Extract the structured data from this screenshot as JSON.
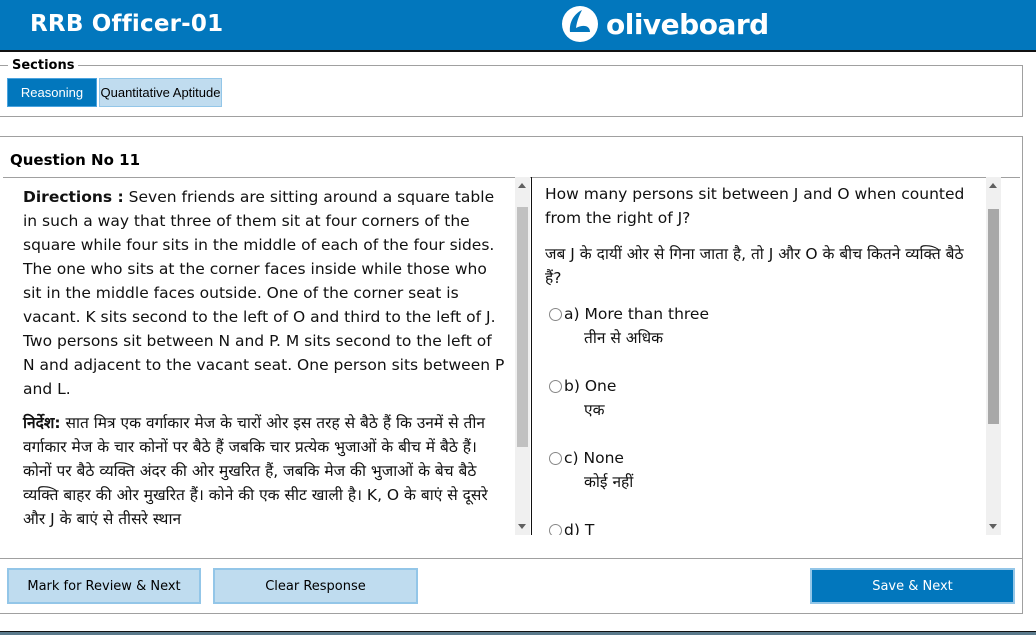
{
  "header": {
    "title": "RRB Officer-01",
    "brand": "oliveboard",
    "logo_icon": "oliveboard-logo-icon",
    "colors": {
      "primary": "#0277bd",
      "tab_inactive": "#c0dcef"
    }
  },
  "sections": {
    "legend": "Sections",
    "tabs": [
      {
        "label": "Reasoning",
        "active": true
      },
      {
        "label": "Quantitative Aptitude",
        "active": false
      }
    ]
  },
  "question": {
    "title": "Question No 11",
    "directions_label": "Directions :",
    "directions_text": " Seven friends are sitting around a square table in such a way that three of them sit at four corners of the square while four sits in the middle of each of the four sides. The one who sits at the corner faces inside while those who sit in the middle faces outside. One of the corner seat is vacant. K sits second to the left of O and third to the left of J. Two persons sit between N and P. M sits second to the left of N and adjacent to the vacant seat. One person sits between P and L.",
    "directions_hi_label": "निर्देश:",
    "directions_hi_text": " सात मित्र एक वर्गाकार मेज के चारों ओर इस तरह से बैठे हैं कि उनमें से तीन वर्गाकार मेज के चार कोनों पर बैठे हैं जबकि चार प्रत्येक भुजाओं के बीच में बैठे हैं। कोनों पर बैठे व्यक्ति अंदर की ओर मुखरित हैं, जबकि मेज की भुजाओं के बेच बैठे व्यक्ति बाहर की ओर मुखरित हैं। कोने की एक सीट खाली है। K, O के बाएं से दूसरे और J के बाएं से तीसरे स्थान",
    "text_en": "How many persons sit between J and O when counted from the right of J?",
    "text_hi": "जब J के दायीं ओर से गिना जाता है, तो J और O के बीच कितने व्यक्ति बैठे हैं?",
    "options": [
      {
        "key": "a)",
        "en": "More than three",
        "hi": "तीन से अधिक",
        "selected": false
      },
      {
        "key": "b)",
        "en": "One",
        "hi": "एक",
        "selected": false
      },
      {
        "key": "c)",
        "en": "None",
        "hi": "कोई नहीं",
        "selected": false
      },
      {
        "key": "d)",
        "en": "T",
        "hi": "",
        "selected": false
      }
    ]
  },
  "actions": {
    "mark_review": "Mark for Review & Next",
    "clear": "Clear Response",
    "save_next": "Save & Next"
  }
}
